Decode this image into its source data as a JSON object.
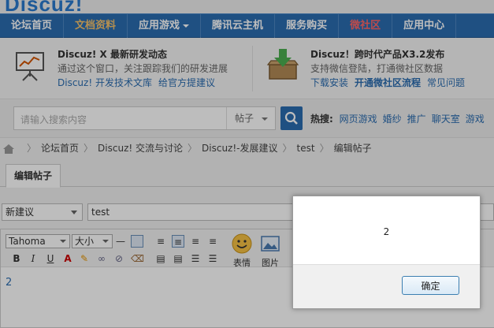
{
  "logo_text": "Discuz!",
  "nav": [
    {
      "label": "论坛首页",
      "style": "normal"
    },
    {
      "label": "文档资料",
      "style": "docs"
    },
    {
      "label": "应用游戏",
      "style": "dropdown"
    },
    {
      "label": "腾讯云主机",
      "style": "normal"
    },
    {
      "label": "服务购买",
      "style": "normal"
    },
    {
      "label": "微社区",
      "style": "wsq"
    },
    {
      "label": "应用中心",
      "style": "normal"
    }
  ],
  "notices": {
    "left": {
      "icon": "presentation-board-icon",
      "title": "Discuz! X 最新研发动态",
      "subtitle": "通过这个窗口，关注跟踪我们的研发进展",
      "links": [
        "Discuz! 开发技术文库",
        "给官方提建议"
      ]
    },
    "right": {
      "icon": "download-box-icon",
      "title": "Discuz！跨时代产品X3.2发布",
      "subtitle": "支持微信登陆，打通微社区数据",
      "links": [
        "下载安装",
        "开通微社区流程",
        "常见问题"
      ]
    }
  },
  "search": {
    "placeholder": "请输入搜索内容",
    "type": "帖子",
    "hot_label": "热搜:",
    "hot_links": [
      "网页游戏",
      "婚纱",
      "推广",
      "聊天室",
      "游戏"
    ]
  },
  "breadcrumb": [
    "论坛首页",
    "Discuz! 交流与讨论",
    "Discuz!-发展建议",
    "test",
    "编辑帖子"
  ],
  "tab": "编辑帖子",
  "form": {
    "category": "新建议",
    "title": "test"
  },
  "toolbar": {
    "font": "Tahoma",
    "size": "大小",
    "emoji_label": "表情",
    "image_label": "图片"
  },
  "editor_content": "2",
  "dialog": {
    "message": "2",
    "ok_label": "确定"
  },
  "colors": {
    "nav_bg": "#2b6cb0",
    "link": "#2b6cb0",
    "docs": "#f4c26b",
    "wsq": "#ff6666"
  }
}
